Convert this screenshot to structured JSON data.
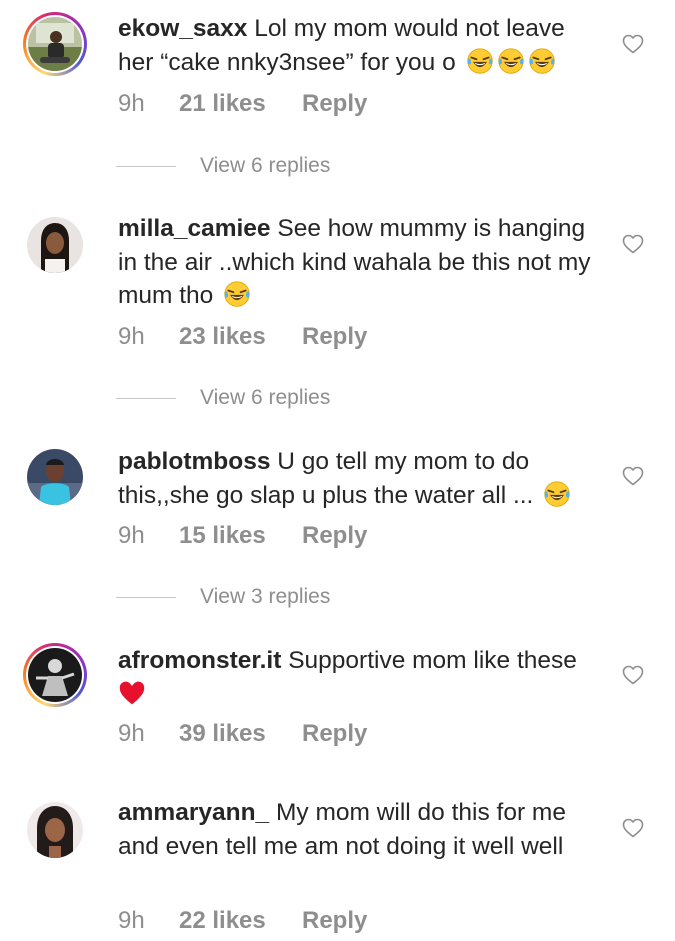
{
  "comments": [
    {
      "username": "ekow_saxx",
      "text": "Lol my mom would not leave her “cake nnky3nsee” for you o",
      "emoji": [
        "laugh",
        "laugh",
        "laugh"
      ],
      "time": "9h",
      "likes": "21 likes",
      "reply": "Reply",
      "replies": "View 6 replies",
      "avatar_ring": true
    },
    {
      "username": "milla_camiee",
      "text": "See how mummy is hanging in the air ..which kind wahala be this not my mum tho",
      "emoji": [
        "laugh"
      ],
      "time": "9h",
      "likes": "23 likes",
      "reply": "Reply",
      "replies": "View 6 replies",
      "avatar_ring": false
    },
    {
      "username": "pablotmboss",
      "text": "U go tell my mom to do this,,she go slap u plus the water all ...",
      "emoji": [
        "laugh"
      ],
      "time": "9h",
      "likes": "15 likes",
      "reply": "Reply",
      "replies": "View 3 replies",
      "avatar_ring": false
    },
    {
      "username": "afromonster.it",
      "text": "Supportive mom like these",
      "emoji": [
        "red-heart"
      ],
      "time": "9h",
      "likes": "39 likes",
      "reply": "Reply",
      "replies": "",
      "avatar_ring": true
    },
    {
      "username": "ammaryann_",
      "text": "My mom will do this for me and even tell me am not doing it well well",
      "emoji": [],
      "time": "9h",
      "likes": "22 likes",
      "reply": "Reply",
      "replies": "",
      "avatar_ring": false
    }
  ],
  "icons": {
    "like": "heart-outline-icon",
    "laugh": "face-with-tears-of-joy-emoji",
    "red-heart": "red-heart-emoji"
  },
  "colors": {
    "text": "#262626",
    "secondary": "#8e8e8e",
    "divider": "#c7c7c7",
    "story_ring": [
      "#feda75",
      "#fa7e1e",
      "#d62976",
      "#962fbf",
      "#4f5bd5"
    ]
  }
}
